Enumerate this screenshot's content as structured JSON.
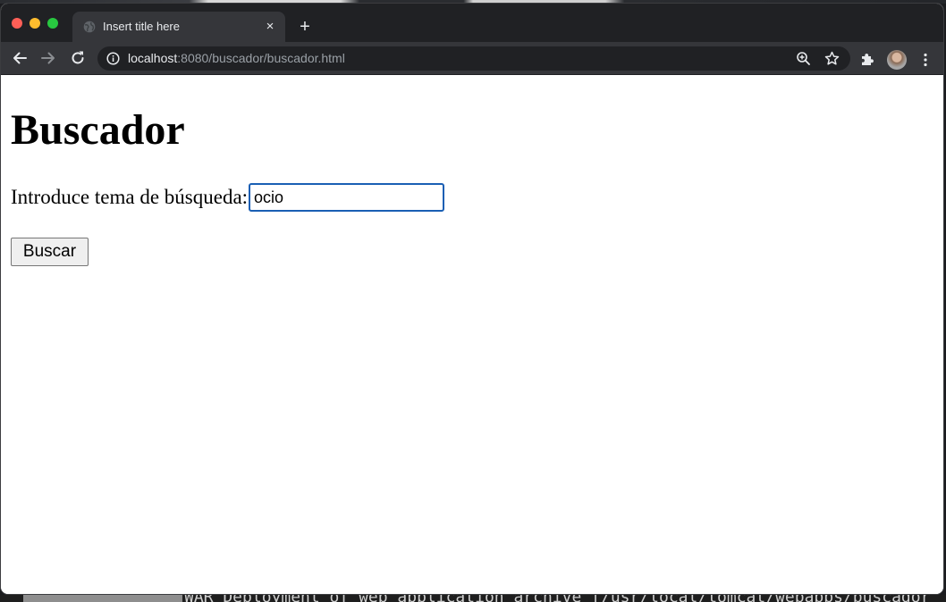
{
  "browser": {
    "tab": {
      "title": "Insert title here",
      "close_label": "×"
    },
    "new_tab_label": "+",
    "address": {
      "host": "localhost",
      "path": ":8080/buscador/buscador.html"
    },
    "colors": {
      "titlebar": "#202124",
      "toolbar": "#35363a",
      "focus_ring": "#1a5fb4"
    }
  },
  "page": {
    "heading": "Buscador",
    "form": {
      "label": "Introduce tema de búsqueda:",
      "input_value": "ocio",
      "submit_label": "Buscar"
    }
  },
  "background": {
    "terminal_text": "WAR Deployment of web application archive [/usr/local/tomcat/webapps/buscador"
  }
}
